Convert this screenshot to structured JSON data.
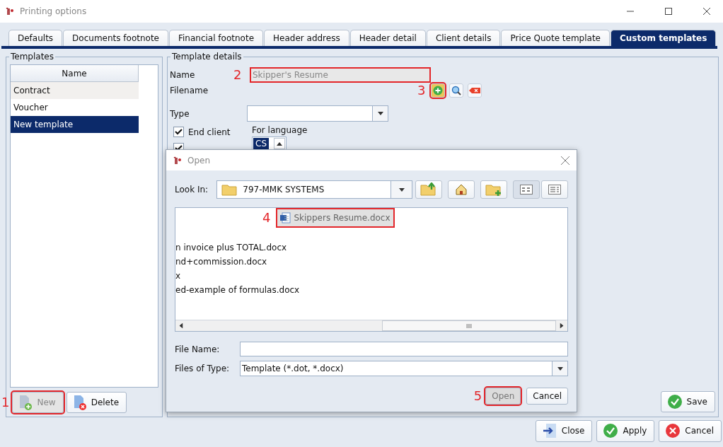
{
  "window": {
    "title": "Printing options"
  },
  "tabs": [
    {
      "label": "Defaults",
      "selected": false
    },
    {
      "label": "Documents footnote",
      "selected": false
    },
    {
      "label": "Financial footnote",
      "selected": false
    },
    {
      "label": "Header address",
      "selected": false
    },
    {
      "label": "Header detail",
      "selected": false
    },
    {
      "label": "Client details",
      "selected": false
    },
    {
      "label": "Price Quote template",
      "selected": false
    },
    {
      "label": "Custom templates",
      "selected": true
    }
  ],
  "templates": {
    "title": "Templates",
    "column": "Name",
    "rows": [
      {
        "label": "Contract",
        "selected": false
      },
      {
        "label": "Voucher",
        "selected": false
      },
      {
        "label": "New template",
        "selected": true
      }
    ],
    "buttons": [
      {
        "label": "New",
        "kind": "new",
        "disabled": true,
        "callout": "1"
      },
      {
        "label": "Delete",
        "kind": "delete",
        "disabled": false
      }
    ]
  },
  "details": {
    "title": "Template details",
    "name_label": "Name",
    "name_value": "Skipper's Resume",
    "name_disabled": true,
    "name_callout": "2",
    "filename_label": "Filename",
    "add_callout": "3",
    "type_label": "Type",
    "checkboxes": [
      {
        "label": "End client",
        "checked": true
      },
      {
        "checked": true
      }
    ],
    "language_label": "For language",
    "languages": [
      {
        "label": "CS",
        "selected": true
      }
    ],
    "save": "Save"
  },
  "dialog": {
    "title": "Open",
    "look_in_label": "Look In:",
    "look_in_value": "797-MMK SYSTEMS",
    "files": [
      {
        "label": "Skippers Resume.docx",
        "selected": true,
        "clipped": false,
        "callout": "4"
      },
      {
        "label": "n invoice plus TOTAL.docx",
        "selected": false,
        "clipped": true
      },
      {
        "label": "nd+commission.docx",
        "selected": false,
        "clipped": true
      },
      {
        "label": "x",
        "selected": false,
        "clipped": true
      },
      {
        "label": "ed-example of formulas.docx",
        "selected": false,
        "clipped": true
      }
    ],
    "file_name_label": "File Name:",
    "file_type_label": "Files of Type:",
    "file_type_value": "Template (*.dot, *.docx)",
    "buttons": [
      {
        "label": "Open",
        "disabled": true,
        "callout": "5"
      },
      {
        "label": "Cancel",
        "disabled": false
      }
    ]
  },
  "footer_buttons": [
    {
      "label": "Close",
      "kind": "close"
    },
    {
      "label": "Apply",
      "kind": "apply"
    },
    {
      "label": "Cancel",
      "kind": "cancel"
    }
  ]
}
